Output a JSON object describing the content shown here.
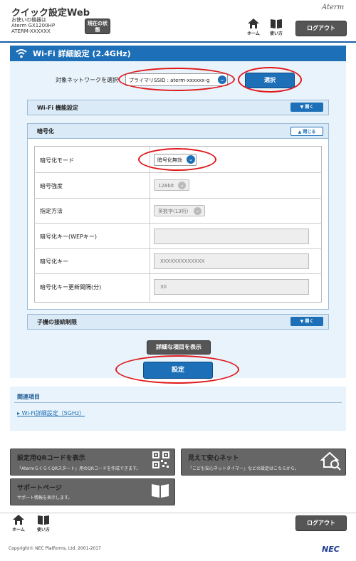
{
  "header": {
    "app_title": "クイック設定Web",
    "device_label": "お使いの機器は",
    "device_model": "Aterm GX1200HP",
    "device_id": "ATERM-XXXXXX",
    "status_button": "現在の状態",
    "home_label": "ホーム",
    "help_label": "使い方",
    "brand": "Aterm",
    "logout": "ログアウト"
  },
  "page": {
    "title": "Wi-Fi 詳細設定 (2.4GHz)",
    "network_label": "対象ネットワークを選択",
    "ssid_value": "プライマリSSID : aterm-xxxxxx-g",
    "select_button": "選択"
  },
  "sections": {
    "wifi_function": "Wi-Fi 機能設定",
    "encryption": "暗号化",
    "client_limit": "子機の接続制限",
    "open_label": "開く",
    "close_label": "閉じる"
  },
  "encryption_rows": [
    {
      "label": "暗号化モード",
      "value": "暗号化無効"
    },
    {
      "label": "暗号強度",
      "value": "128bit"
    },
    {
      "label": "指定方法",
      "value": "英数字(13桁)"
    },
    {
      "label": "暗号化キー(WEPキー)",
      "value": ""
    },
    {
      "label": "暗号化キー",
      "value": "XXXXXXXXXXXXX"
    },
    {
      "label": "暗号化キー更新間隔(分)",
      "value": "30"
    }
  ],
  "buttons": {
    "show_advanced": "詳細な項目を表示",
    "save": "設定"
  },
  "related": {
    "title": "関連項目",
    "link": "Wi-Fi詳細設定（5GHz）"
  },
  "cards": [
    {
      "title": "設定用QRコードを表示",
      "desc": "「AtermらくらくQRスタート」用のQRコードを作成できます。"
    },
    {
      "title": "見えて安心ネット",
      "desc": "「こども安心ネットタイマー」などの設定はこちらから。"
    },
    {
      "title": "サポートページ",
      "desc": "サポート情報を表示します。"
    }
  ],
  "footer": {
    "home_label": "ホーム",
    "help_label": "使い方",
    "logout": "ログアウト",
    "copyright": "Copyright© NEC Platforms, Ltd. 2001-2017",
    "brand": "NEC"
  },
  "colors": {
    "accent": "#1d6fb8",
    "annotation": "#e0191c",
    "panel": "#e8f3fb"
  }
}
